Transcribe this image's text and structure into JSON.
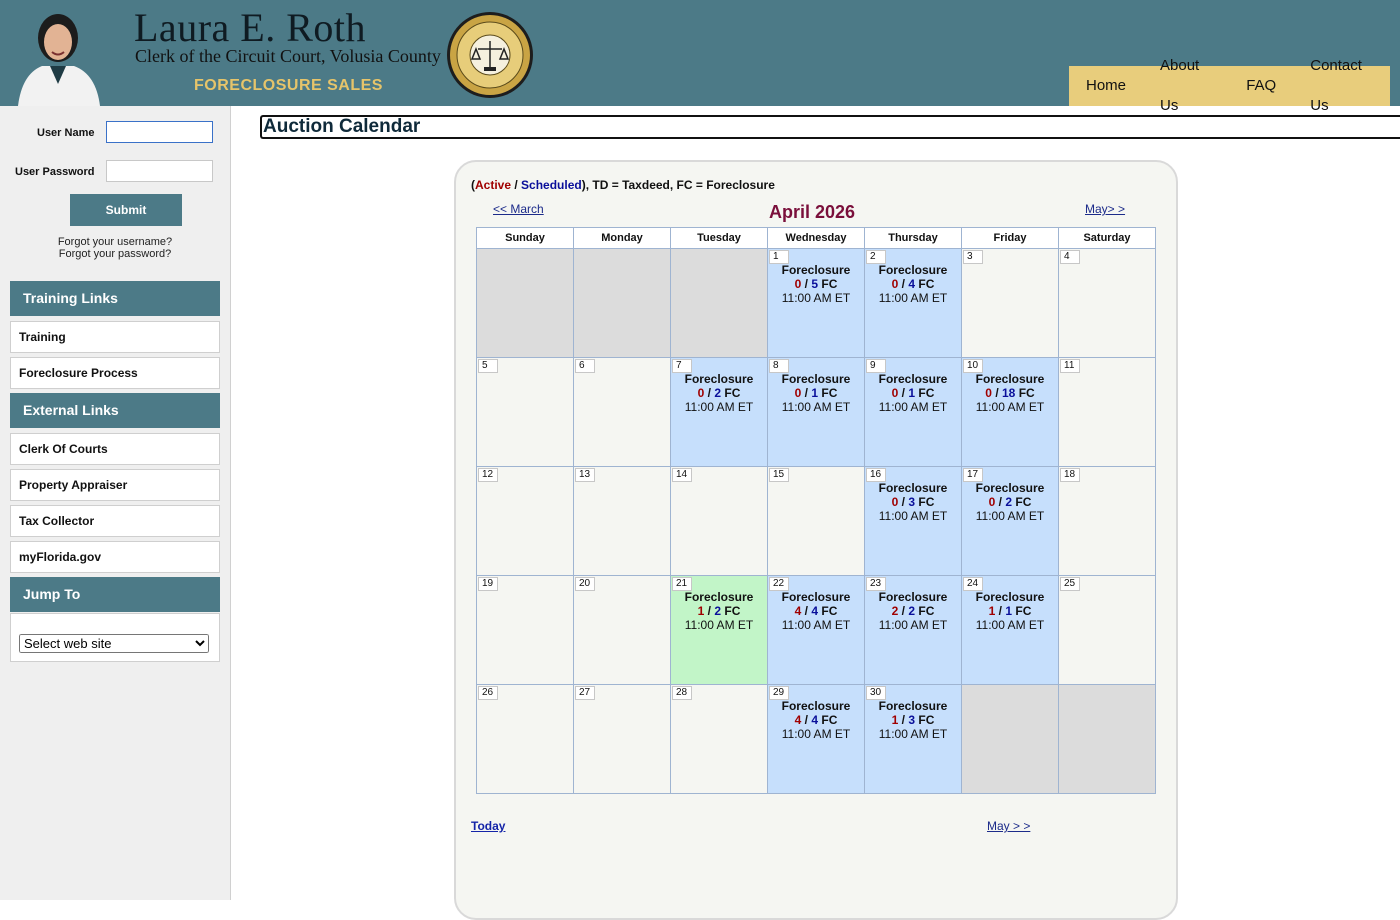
{
  "header": {
    "name": "Laura E. Roth",
    "subtitle": "Clerk of the Circuit Court, Volusia County",
    "tagline": "FORECLOSURE SALES",
    "seal_text": "CIRCUIT COURT CLERK",
    "nav": [
      "Home",
      "About Us",
      "FAQ",
      "Contact Us"
    ]
  },
  "login": {
    "user_label": "User Name",
    "pass_label": "User Password",
    "user_value": "",
    "pass_value": "",
    "submit": "Submit",
    "forgot_user": "Forgot your username?",
    "forgot_pass": "Forgot your password?"
  },
  "sidebar": {
    "training_head": "Training Links",
    "training_links": [
      "Training",
      "Foreclosure Process"
    ],
    "external_head": "External Links",
    "external_links": [
      "Clerk Of Courts",
      "Property Appraiser",
      "Tax Collector",
      "myFlorida.gov"
    ],
    "jump_head": "Jump To",
    "jump_select": "Select web site"
  },
  "main": {
    "title": "Auction Calendar",
    "legend_active": "Active",
    "legend_sep": " / ",
    "legend_scheduled": "Scheduled",
    "legend_rest": "), TD = Taxdeed, FC = Foreclosure",
    "prev": "<< March",
    "next": "May> >",
    "month": "April 2026",
    "today": "Today",
    "next_bottom": "May > >"
  },
  "calendar": {
    "weekdays": [
      "Sunday",
      "Monday",
      "Tuesday",
      "Wednesday",
      "Thursday",
      "Friday",
      "Saturday"
    ],
    "weeks": [
      [
        null,
        null,
        null,
        {
          "day": "1",
          "kind": "Foreclosure",
          "active": "0",
          "scheduled": "5",
          "type": "FC",
          "time": "11:00 AM ET",
          "state": "sched"
        },
        {
          "day": "2",
          "kind": "Foreclosure",
          "active": "0",
          "scheduled": "4",
          "type": "FC",
          "time": "11:00 AM ET",
          "state": "sched"
        },
        {
          "day": "3"
        },
        {
          "day": "4"
        }
      ],
      [
        {
          "day": "5"
        },
        {
          "day": "6"
        },
        {
          "day": "7",
          "kind": "Foreclosure",
          "active": "0",
          "scheduled": "2",
          "type": "FC",
          "time": "11:00 AM ET",
          "state": "sched"
        },
        {
          "day": "8",
          "kind": "Foreclosure",
          "active": "0",
          "scheduled": "1",
          "type": "FC",
          "time": "11:00 AM ET",
          "state": "sched"
        },
        {
          "day": "9",
          "kind": "Foreclosure",
          "active": "0",
          "scheduled": "1",
          "type": "FC",
          "time": "11:00 AM ET",
          "state": "sched"
        },
        {
          "day": "10",
          "kind": "Foreclosure",
          "active": "0",
          "scheduled": "18",
          "type": "FC",
          "time": "11:00 AM ET",
          "state": "sched"
        },
        {
          "day": "11"
        }
      ],
      [
        {
          "day": "12"
        },
        {
          "day": "13"
        },
        {
          "day": "14"
        },
        {
          "day": "15"
        },
        {
          "day": "16",
          "kind": "Foreclosure",
          "active": "0",
          "scheduled": "3",
          "type": "FC",
          "time": "11:00 AM ET",
          "state": "sched"
        },
        {
          "day": "17",
          "kind": "Foreclosure",
          "active": "0",
          "scheduled": "2",
          "type": "FC",
          "time": "11:00 AM ET",
          "state": "sched"
        },
        {
          "day": "18"
        }
      ],
      [
        {
          "day": "19"
        },
        {
          "day": "20"
        },
        {
          "day": "21",
          "kind": "Foreclosure",
          "active": "1",
          "scheduled": "2",
          "type": "FC",
          "time": "11:00 AM ET",
          "state": "active"
        },
        {
          "day": "22",
          "kind": "Foreclosure",
          "active": "4",
          "scheduled": "4",
          "type": "FC",
          "time": "11:00 AM ET",
          "state": "sched"
        },
        {
          "day": "23",
          "kind": "Foreclosure",
          "active": "2",
          "scheduled": "2",
          "type": "FC",
          "time": "11:00 AM ET",
          "state": "sched"
        },
        {
          "day": "24",
          "kind": "Foreclosure",
          "active": "1",
          "scheduled": "1",
          "type": "FC",
          "time": "11:00 AM ET",
          "state": "sched"
        },
        {
          "day": "25"
        }
      ],
      [
        {
          "day": "26"
        },
        {
          "day": "27"
        },
        {
          "day": "28"
        },
        {
          "day": "29",
          "kind": "Foreclosure",
          "active": "4",
          "scheduled": "4",
          "type": "FC",
          "time": "11:00 AM ET",
          "state": "sched"
        },
        {
          "day": "30",
          "kind": "Foreclosure",
          "active": "1",
          "scheduled": "3",
          "type": "FC",
          "time": "11:00 AM ET",
          "state": "sched"
        },
        null,
        null
      ]
    ]
  }
}
